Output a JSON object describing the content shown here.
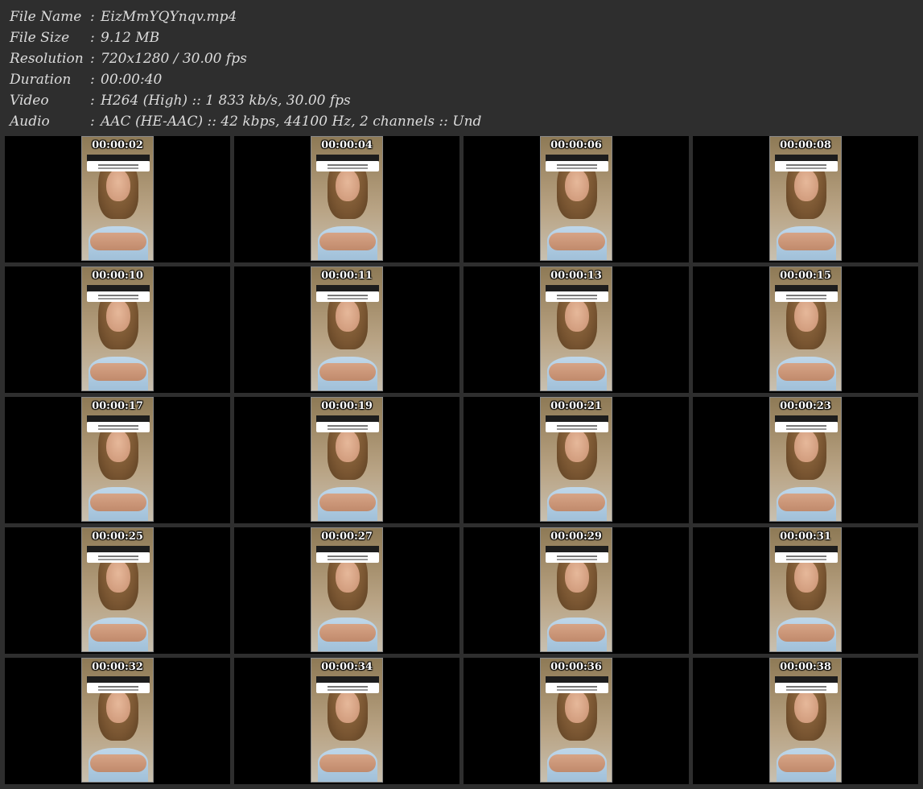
{
  "info": [
    {
      "label": "File Name",
      "sep": ":",
      "value": "EizMmYQYnqv.mp4"
    },
    {
      "label": "File Size",
      "sep": ":",
      "value": "9.12 MB"
    },
    {
      "label": "Resolution",
      "sep": ":",
      "value": "720x1280 / 30.00 fps"
    },
    {
      "label": "Duration",
      "sep": ":",
      "value": "00:00:40"
    },
    {
      "label": "Video",
      "sep": ":",
      "value": "H264 (High) :: 1 833 kb/s, 30.00 fps"
    },
    {
      "label": "Audio",
      "sep": ":",
      "value": "AAC (HE-AAC) :: 42 kbps, 44100 Hz, 2 channels :: Und"
    }
  ],
  "thumbnails": [
    {
      "time": "00:00:02"
    },
    {
      "time": "00:00:04"
    },
    {
      "time": "00:00:06"
    },
    {
      "time": "00:00:08"
    },
    {
      "time": "00:00:10"
    },
    {
      "time": "00:00:11"
    },
    {
      "time": "00:00:13"
    },
    {
      "time": "00:00:15"
    },
    {
      "time": "00:00:17"
    },
    {
      "time": "00:00:19"
    },
    {
      "time": "00:00:21"
    },
    {
      "time": "00:00:23"
    },
    {
      "time": "00:00:25"
    },
    {
      "time": "00:00:27"
    },
    {
      "time": "00:00:29"
    },
    {
      "time": "00:00:31"
    },
    {
      "time": "00:00:32"
    },
    {
      "time": "00:00:34"
    },
    {
      "time": "00:00:36"
    },
    {
      "time": "00:00:38"
    }
  ]
}
